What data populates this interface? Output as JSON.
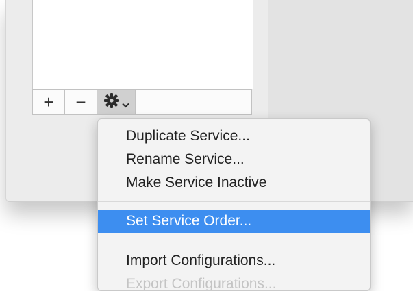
{
  "toolbar": {
    "add_symbol": "+",
    "remove_symbol": "−",
    "actions_symbol": "✱",
    "chevron_symbol": "⌄"
  },
  "menu": {
    "items": [
      {
        "label": "Duplicate Service..."
      },
      {
        "label": "Rename Service..."
      },
      {
        "label": "Make Service Inactive"
      },
      {
        "label": "Set Service Order..."
      },
      {
        "label": "Import Configurations..."
      },
      {
        "label": "Export Configurations..."
      }
    ],
    "selected_index": 3,
    "selected_color": "#3d8ef0"
  }
}
